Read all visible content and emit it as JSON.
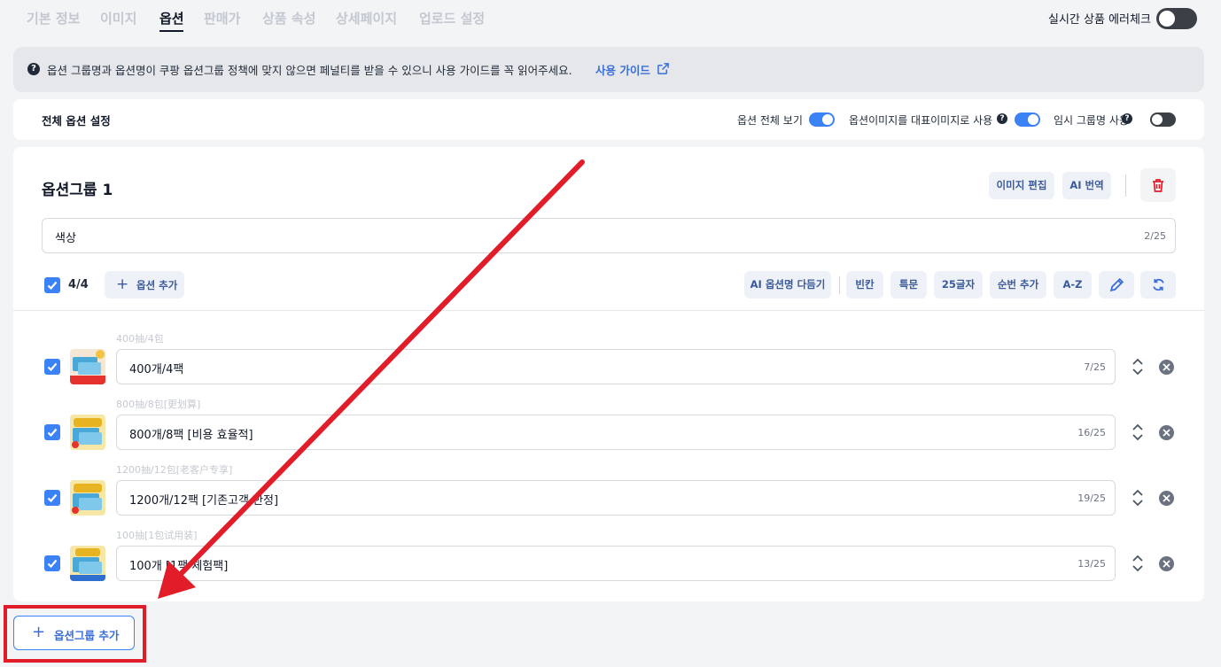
{
  "tabs": [
    {
      "label": "기본 정보",
      "active": false
    },
    {
      "label": "이미지",
      "active": false
    },
    {
      "label": "옵션",
      "active": true
    },
    {
      "label": "판매가",
      "active": false
    },
    {
      "label": "상품 속성",
      "active": false
    },
    {
      "label": "상세페이지",
      "active": false
    },
    {
      "label": "업로드 설정",
      "active": false
    }
  ],
  "live_check": {
    "label": "실시간 상품 에러체크",
    "on": false
  },
  "notice": {
    "text": "옵션 그룹명과 옵션명이 쿠팡 옵션그룹 정책에 맞지 않으면 페널티를 받을 수 있으니 사용 가이드를 꼭 읽어주세요.",
    "link": "사용 가이드",
    "icon": "help-icon"
  },
  "settings": {
    "title": "전체 옵션 설정",
    "show_all": {
      "label": "옵션 전체 보기",
      "on": true
    },
    "option_image_main": {
      "label": "옵션이미지를 대표이미지로 사용",
      "on": true
    },
    "temp_group_name": {
      "label": "임시 그룹명 사용",
      "on": false
    },
    "help": "?"
  },
  "group": {
    "title": "옵션그룹 1",
    "image_edit": "이미지 편집",
    "ai_translate": "AI 번역",
    "name_value": "색상",
    "name_count": "2/25",
    "selected_count": "4/4",
    "add_option": "옵션 추가",
    "tools": {
      "ai_clean": "AI 옵션명 다듬기",
      "blank": "빈칸",
      "special": "특문",
      "chars25": "25글자",
      "seq_add": "순번 추가",
      "az": "A-Z"
    },
    "options": [
      {
        "original": "400抽/4包",
        "value": "400개/4팩",
        "count": "7/25",
        "checked": true
      },
      {
        "original": "800抽/8包[更划算]",
        "value": "800개/8팩 [비용 효율적]",
        "count": "16/25",
        "checked": true
      },
      {
        "original": "1200抽/12包[老客户专享]",
        "value": "1200개/12팩 [기존고객 한정]",
        "count": "19/25",
        "checked": true
      },
      {
        "original": "100抽[1包试用装]",
        "value": "100개 [1팩 체험팩]",
        "count": "13/25",
        "checked": true
      }
    ]
  },
  "add_group": "옵션그룹 추가",
  "colors": {
    "accent": "#3b82f6",
    "annotation": "#e11d2a"
  }
}
